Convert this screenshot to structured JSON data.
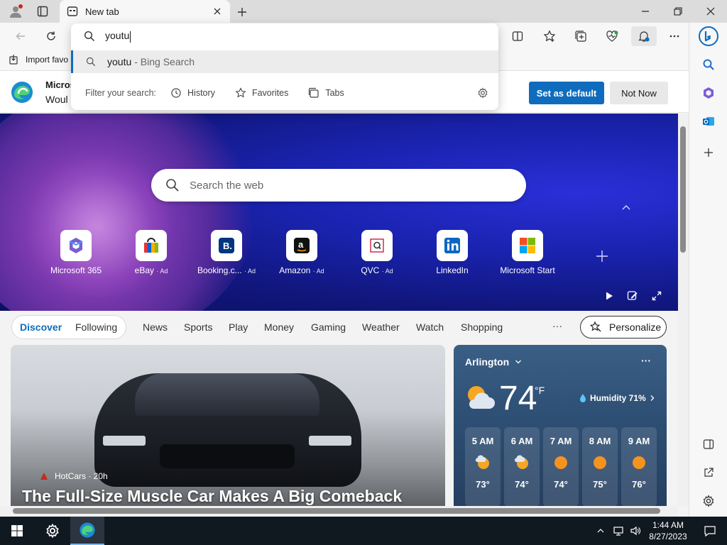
{
  "tab": {
    "title": "New tab"
  },
  "omnibox": {
    "value": "youtu",
    "suggestion_query": "youtu",
    "suggestion_suffix": "- Bing Search",
    "filter_label": "Filter your search:",
    "filters": [
      "History",
      "Favorites",
      "Tabs"
    ]
  },
  "favorites_bar": {
    "import_label": "Import favo"
  },
  "banner": {
    "title": "Micros",
    "subtitle": "Woul",
    "set_default": "Set as default",
    "not_now": "Not Now"
  },
  "hero": {
    "search_placeholder": "Search the web",
    "tiles": [
      {
        "label": "Microsoft 365",
        "ad": ""
      },
      {
        "label": "eBay",
        "ad": "· Ad"
      },
      {
        "label": "Booking.c...",
        "ad": "· Ad"
      },
      {
        "label": "Amazon",
        "ad": "· Ad"
      },
      {
        "label": "QVC",
        "ad": "· Ad"
      },
      {
        "label": "LinkedIn",
        "ad": ""
      },
      {
        "label": "Microsoft Start",
        "ad": ""
      }
    ]
  },
  "feed": {
    "tabs": [
      "Discover",
      "Following",
      "News",
      "Sports",
      "Play",
      "Money",
      "Gaming",
      "Weather",
      "Watch",
      "Shopping"
    ],
    "more": "···",
    "personalize": "Personalize"
  },
  "news": {
    "source": "HotCars · 20h",
    "headline": "The Full-Size Muscle Car Makes A Big Comeback"
  },
  "weather": {
    "city": "Arlington",
    "more": "···",
    "temp": "74",
    "unit": "°F",
    "humidity": "Humidity 71%",
    "hours": [
      {
        "time": "5 AM",
        "temp": "73°",
        "icon": "partly-cloudy-icon"
      },
      {
        "time": "6 AM",
        "temp": "74°",
        "icon": "partly-cloudy-icon"
      },
      {
        "time": "7 AM",
        "temp": "74°",
        "icon": "sun-icon"
      },
      {
        "time": "8 AM",
        "temp": "75°",
        "icon": "sun-icon"
      },
      {
        "time": "9 AM",
        "temp": "76°",
        "icon": "sun-icon"
      }
    ]
  },
  "taskbar": {
    "time": "1:44 AM",
    "date": "8/27/2023"
  },
  "colors": {
    "accent": "#0f6cbd",
    "taskbar": "#101820",
    "hero": "#1a23b0"
  }
}
